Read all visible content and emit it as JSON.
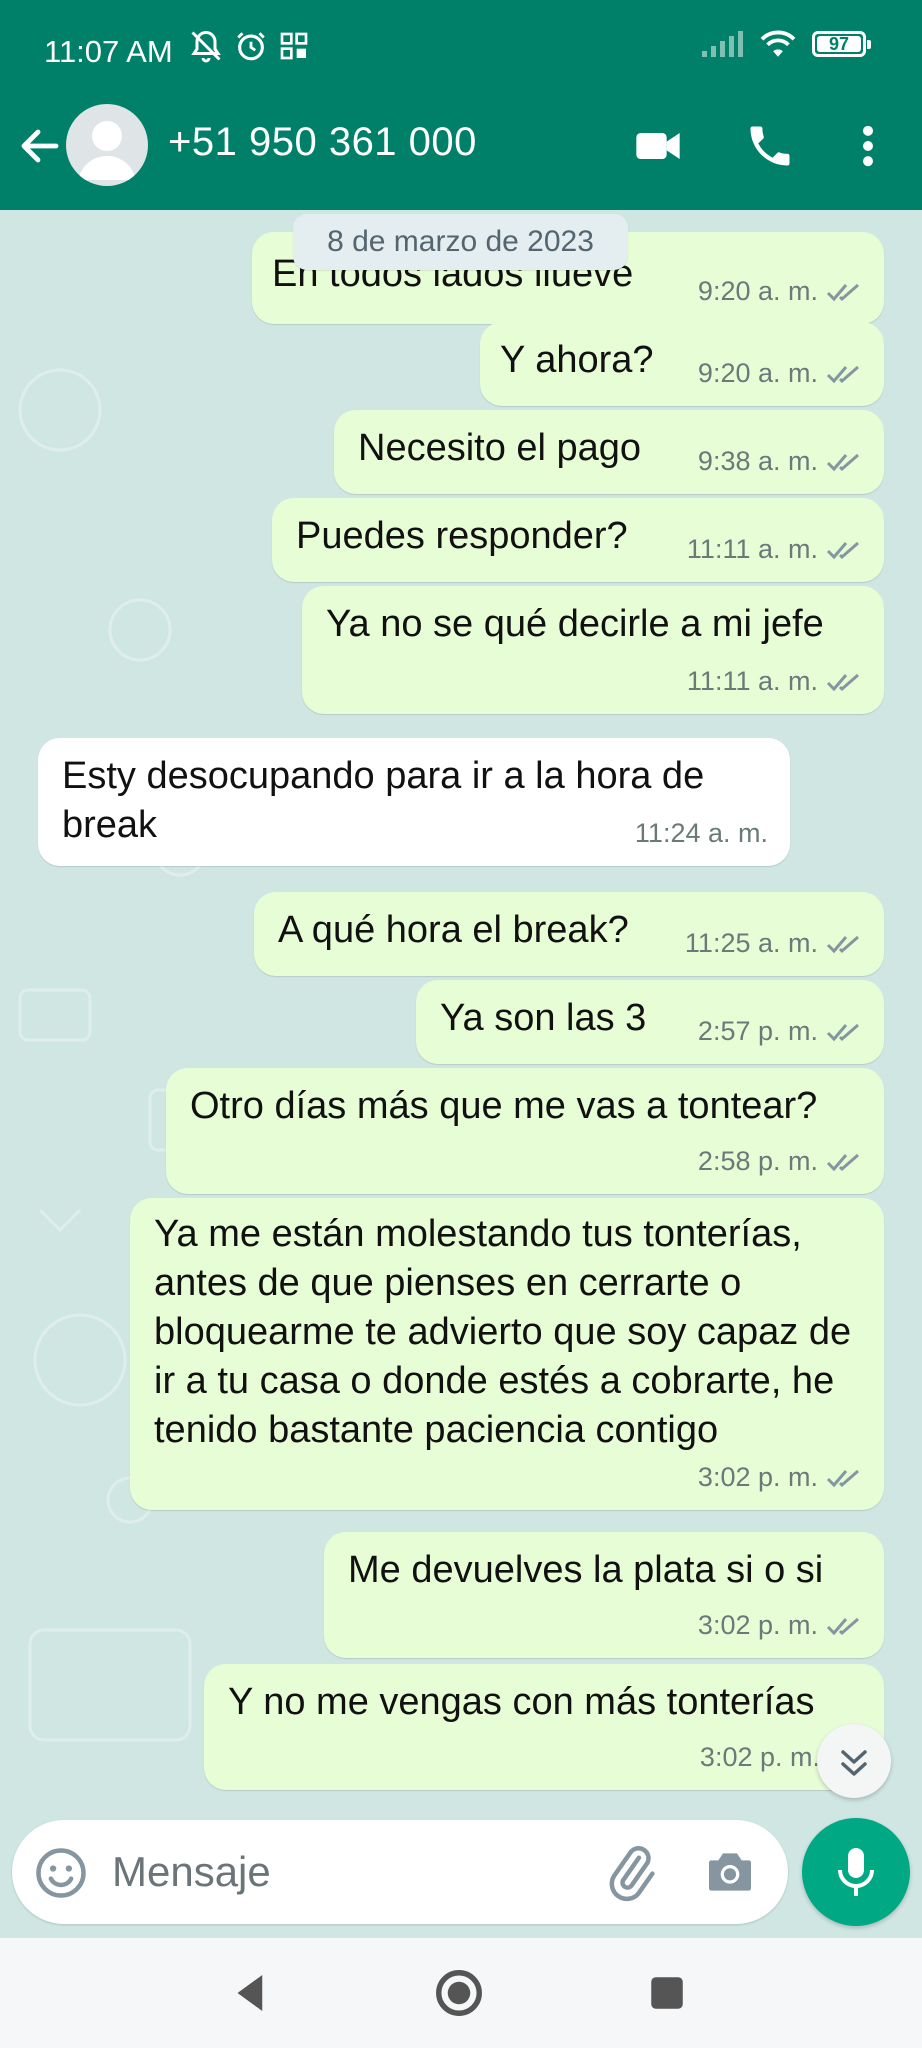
{
  "status_bar": {
    "time": "11:07 AM",
    "battery": "97"
  },
  "header": {
    "contact_name": "+51 950 361 000"
  },
  "chat": {
    "date_chip": "8 de marzo de 2023",
    "messages": [
      {
        "text": "En todos lados llueve",
        "time": "9:20 a. m.",
        "direction": "out"
      },
      {
        "text": "Y ahora?",
        "time": "9:20 a. m.",
        "direction": "out"
      },
      {
        "text": "Necesito el pago",
        "time": "9:38 a. m.",
        "direction": "out"
      },
      {
        "text": "Puedes responder?",
        "time": "11:11 a. m.",
        "direction": "out"
      },
      {
        "text": "Ya no se qué decirle a mi jefe",
        "time": "11:11 a. m.",
        "direction": "out"
      },
      {
        "text": "Esty desocupando para ir a la hora de break",
        "time": "11:24 a. m.",
        "direction": "in"
      },
      {
        "text": "A qué hora el break?",
        "time": "11:25 a. m.",
        "direction": "out"
      },
      {
        "text": "Ya son las 3",
        "time": "2:57 p. m.",
        "direction": "out"
      },
      {
        "text": "Otro días más que me vas a tontear?",
        "time": "2:58 p. m.",
        "direction": "out"
      },
      {
        "text": "Ya me están molestando tus tonterías, antes de que pienses en cerrarte o bloquearme te advierto que soy capaz de ir a tu casa o donde estés a cobrarte, he tenido bastante paciencia contigo",
        "time": "3:02 p. m.",
        "direction": "out"
      },
      {
        "text": "Me devuelves la plata si o si",
        "time": "3:02 p. m.",
        "direction": "out"
      },
      {
        "text": "Y no me vengas con más tonterías",
        "time": "3:02 p. m.",
        "direction": "out"
      }
    ]
  },
  "composer": {
    "placeholder": "Mensaje"
  },
  "colors": {
    "header": "#008069",
    "outgoing_bubble": "#e7fdd6",
    "incoming_bubble": "#ffffff",
    "chat_background": "#cfe6e3",
    "read_ticks": "#6b7a79",
    "mic_button": "#00a884"
  }
}
